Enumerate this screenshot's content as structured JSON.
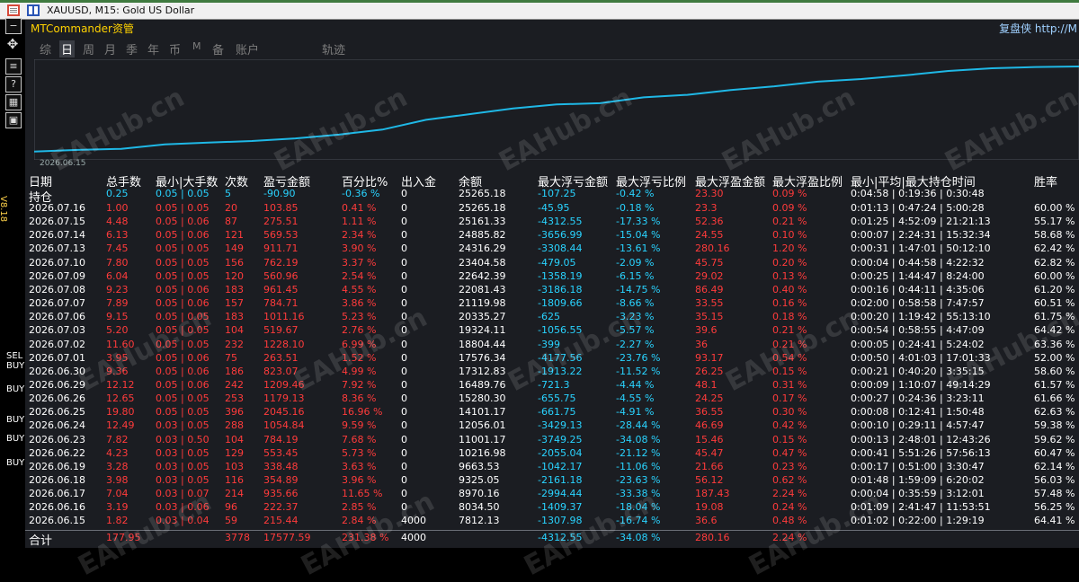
{
  "window": {
    "title": "XAUUSD, M15:  Gold US Dollar"
  },
  "panel": {
    "brand": "MTCommander资管",
    "right_brand": "复盘侠 http://M",
    "version": "V8.18",
    "chart_start_date": "2026.06.15"
  },
  "tabs": [
    "综",
    "日",
    "周",
    "月",
    "季",
    "年",
    "币",
    "M",
    "备",
    "账户",
    "轨迹"
  ],
  "active_tab": "日",
  "side_labels": [
    "SEL",
    "BUY",
    "BUY",
    "BUY",
    "BUY",
    "BUY"
  ],
  "watermark": "EAHub.cn",
  "columns": [
    "日期",
    "总手数",
    "最小|大手数",
    "次数",
    "盈亏金额",
    "百分比%",
    "出入金",
    "余额",
    "最大浮亏金额",
    "最大浮亏比例",
    "最大浮盈金额",
    "最大浮盈比例",
    "最小|平均|最大持仓时间",
    "胜率"
  ],
  "holding": [
    "持仓",
    "0.25",
    "0.05 | 0.05",
    "5",
    "-90.90",
    "-0.36 %",
    "0",
    "25265.18",
    "-107.25",
    "-0.42 %",
    "23.30",
    "0.09 %",
    "0:04:58 | 0:19:36 | 0:30:48",
    ""
  ],
  "rows": [
    [
      "2026.07.16",
      "1.00",
      "0.05 | 0.05",
      "20",
      "103.85",
      "0.41 %",
      "0",
      "25265.18",
      "-45.95",
      "-0.18 %",
      "23.3",
      "0.09 %",
      "0:01:13 | 0:47:24 | 5:00:28",
      "60.00 %"
    ],
    [
      "2026.07.15",
      "4.48",
      "0.05 | 0.06",
      "87",
      "275.51",
      "1.11 %",
      "0",
      "25161.33",
      "-4312.55",
      "-17.33 %",
      "52.36",
      "0.21 %",
      "0:01:25 | 4:52:09 | 21:21:13",
      "55.17 %"
    ],
    [
      "2026.07.14",
      "6.13",
      "0.05 | 0.06",
      "121",
      "569.53",
      "2.34 %",
      "0",
      "24885.82",
      "-3656.99",
      "-15.04 %",
      "24.55",
      "0.10 %",
      "0:00:07 | 2:24:31 | 15:32:34",
      "58.68 %"
    ],
    [
      "2026.07.13",
      "7.45",
      "0.05 | 0.05",
      "149",
      "911.71",
      "3.90 %",
      "0",
      "24316.29",
      "-3308.44",
      "-13.61 %",
      "280.16",
      "1.20 %",
      "0:00:31 | 1:47:01 | 50:12:10",
      "62.42 %"
    ],
    [
      "2026.07.10",
      "7.80",
      "0.05 | 0.05",
      "156",
      "762.19",
      "3.37 %",
      "0",
      "23404.58",
      "-479.05",
      "-2.09 %",
      "45.75",
      "0.20 %",
      "0:00:04 | 0:44:58 | 4:22:32",
      "62.82 %"
    ],
    [
      "2026.07.09",
      "6.04",
      "0.05 | 0.05",
      "120",
      "560.96",
      "2.54 %",
      "0",
      "22642.39",
      "-1358.19",
      "-6.15 %",
      "29.02",
      "0.13 %",
      "0:00:25 | 1:44:47 | 8:24:00",
      "60.00 %"
    ],
    [
      "2026.07.08",
      "9.23",
      "0.05 | 0.06",
      "183",
      "961.45",
      "4.55 %",
      "0",
      "22081.43",
      "-3186.18",
      "-14.75 %",
      "86.49",
      "0.40 %",
      "0:00:16 | 0:44:11 | 4:35:06",
      "61.20 %"
    ],
    [
      "2026.07.07",
      "7.89",
      "0.05 | 0.06",
      "157",
      "784.71",
      "3.86 %",
      "0",
      "21119.98",
      "-1809.66",
      "-8.66 %",
      "33.55",
      "0.16 %",
      "0:02:00 | 0:58:58 | 7:47:57",
      "60.51 %"
    ],
    [
      "2026.07.06",
      "9.15",
      "0.05 | 0.05",
      "183",
      "1011.16",
      "5.23 %",
      "0",
      "20335.27",
      "-625",
      "-3.23 %",
      "35.15",
      "0.18 %",
      "0:00:20 | 1:19:42 | 55:13:10",
      "61.75 %"
    ],
    [
      "2026.07.03",
      "5.20",
      "0.05 | 0.05",
      "104",
      "519.67",
      "2.76 %",
      "0",
      "19324.11",
      "-1056.55",
      "-5.57 %",
      "39.6",
      "0.21 %",
      "0:00:54 | 0:58:55 | 4:47:09",
      "64.42 %"
    ],
    [
      "2026.07.02",
      "11.60",
      "0.05 | 0.05",
      "232",
      "1228.10",
      "6.99 %",
      "0",
      "18804.44",
      "-399",
      "-2.27 %",
      "36",
      "0.21 %",
      "0:00:05 | 0:24:41 | 5:24:02",
      "63.36 %"
    ],
    [
      "2026.07.01",
      "3.95",
      "0.05 | 0.06",
      "75",
      "263.51",
      "1.52 %",
      "0",
      "17576.34",
      "-4177.56",
      "-23.76 %",
      "93.17",
      "0.54 %",
      "0:00:50 | 4:01:03 | 17:01:33",
      "52.00 %"
    ],
    [
      "2026.06.30",
      "9.36",
      "0.05 | 0.06",
      "186",
      "823.07",
      "4.99 %",
      "0",
      "17312.83",
      "-1913.22",
      "-11.52 %",
      "26.25",
      "0.15 %",
      "0:00:21 | 0:40:20 | 3:35:15",
      "58.60 %"
    ],
    [
      "2026.06.29",
      "12.12",
      "0.05 | 0.06",
      "242",
      "1209.46",
      "7.92 %",
      "0",
      "16489.76",
      "-721.3",
      "-4.44 %",
      "48.1",
      "0.31 %",
      "0:00:09 | 1:10:07 | 49:14:29",
      "61.57 %"
    ],
    [
      "2026.06.26",
      "12.65",
      "0.05 | 0.05",
      "253",
      "1179.13",
      "8.36 %",
      "0",
      "15280.30",
      "-655.75",
      "-4.55 %",
      "24.25",
      "0.17 %",
      "0:00:27 | 0:24:36 | 3:23:11",
      "61.66 %"
    ],
    [
      "2026.06.25",
      "19.80",
      "0.05 | 0.05",
      "396",
      "2045.16",
      "16.96 %",
      "0",
      "14101.17",
      "-661.75",
      "-4.91 %",
      "36.55",
      "0.30 %",
      "0:00:08 | 0:12:41 | 1:50:48",
      "62.63 %"
    ],
    [
      "2026.06.24",
      "12.49",
      "0.03 | 0.05",
      "288",
      "1054.84",
      "9.59 %",
      "0",
      "12056.01",
      "-3429.13",
      "-28.44 %",
      "46.69",
      "0.42 %",
      "0:00:10 | 0:29:11 | 4:57:47",
      "59.38 %"
    ],
    [
      "2026.06.23",
      "7.82",
      "0.03 | 0.50",
      "104",
      "784.19",
      "7.68 %",
      "0",
      "11001.17",
      "-3749.25",
      "-34.08 %",
      "15.46",
      "0.15 %",
      "0:00:13 | 2:48:01 | 12:43:26",
      "59.62 %"
    ],
    [
      "2026.06.22",
      "4.23",
      "0.03 | 0.05",
      "129",
      "553.45",
      "5.73 %",
      "0",
      "10216.98",
      "-2055.04",
      "-21.12 %",
      "45.47",
      "0.47 %",
      "0:00:41 | 5:51:26 | 57:56:13",
      "60.47 %"
    ],
    [
      "2026.06.19",
      "3.28",
      "0.03 | 0.05",
      "103",
      "338.48",
      "3.63 %",
      "0",
      "9663.53",
      "-1042.17",
      "-11.06 %",
      "21.66",
      "0.23 %",
      "0:00:17 | 0:51:00 | 3:30:47",
      "62.14 %"
    ],
    [
      "2026.06.18",
      "3.98",
      "0.03 | 0.05",
      "116",
      "354.89",
      "3.96 %",
      "0",
      "9325.05",
      "-2161.18",
      "-23.63 %",
      "56.12",
      "0.62 %",
      "0:01:48 | 1:59:09 | 6:20:02",
      "56.03 %"
    ],
    [
      "2026.06.17",
      "7.04",
      "0.03 | 0.07",
      "214",
      "935.66",
      "11.65 %",
      "0",
      "8970.16",
      "-2994.44",
      "-33.38 %",
      "187.43",
      "2.24 %",
      "0:00:04 | 0:35:59 | 3:12:01",
      "57.48 %"
    ],
    [
      "2026.06.16",
      "3.19",
      "0.03 | 0.06",
      "96",
      "222.37",
      "2.85 %",
      "0",
      "8034.50",
      "-1409.37",
      "-18.04 %",
      "19.08",
      "0.24 %",
      "0:01:09 | 2:41:47 | 11:53:51",
      "56.25 %"
    ],
    [
      "2026.06.15",
      "1.82",
      "0.03 | 0.04",
      "59",
      "215.44",
      "2.84 %",
      "4000",
      "7812.13",
      "-1307.98",
      "-16.74 %",
      "36.6",
      "0.48 %",
      "0:01:02 | 0:22:00 | 1:29:19",
      "64.41 %"
    ]
  ],
  "total": [
    "合计",
    "177.95",
    "",
    "3778",
    "17577.59",
    "231.38 %",
    "4000",
    "",
    "-4312.55",
    "-34.08 %",
    "280.16",
    "2.24 %",
    "",
    ""
  ],
  "colors": {
    "accent_red": "#ff3b3b",
    "accent_cyan": "#29d3ff",
    "brand_yellow": "#ffd200",
    "line": "#1fb8e6",
    "bg": "#1b1d22"
  }
}
